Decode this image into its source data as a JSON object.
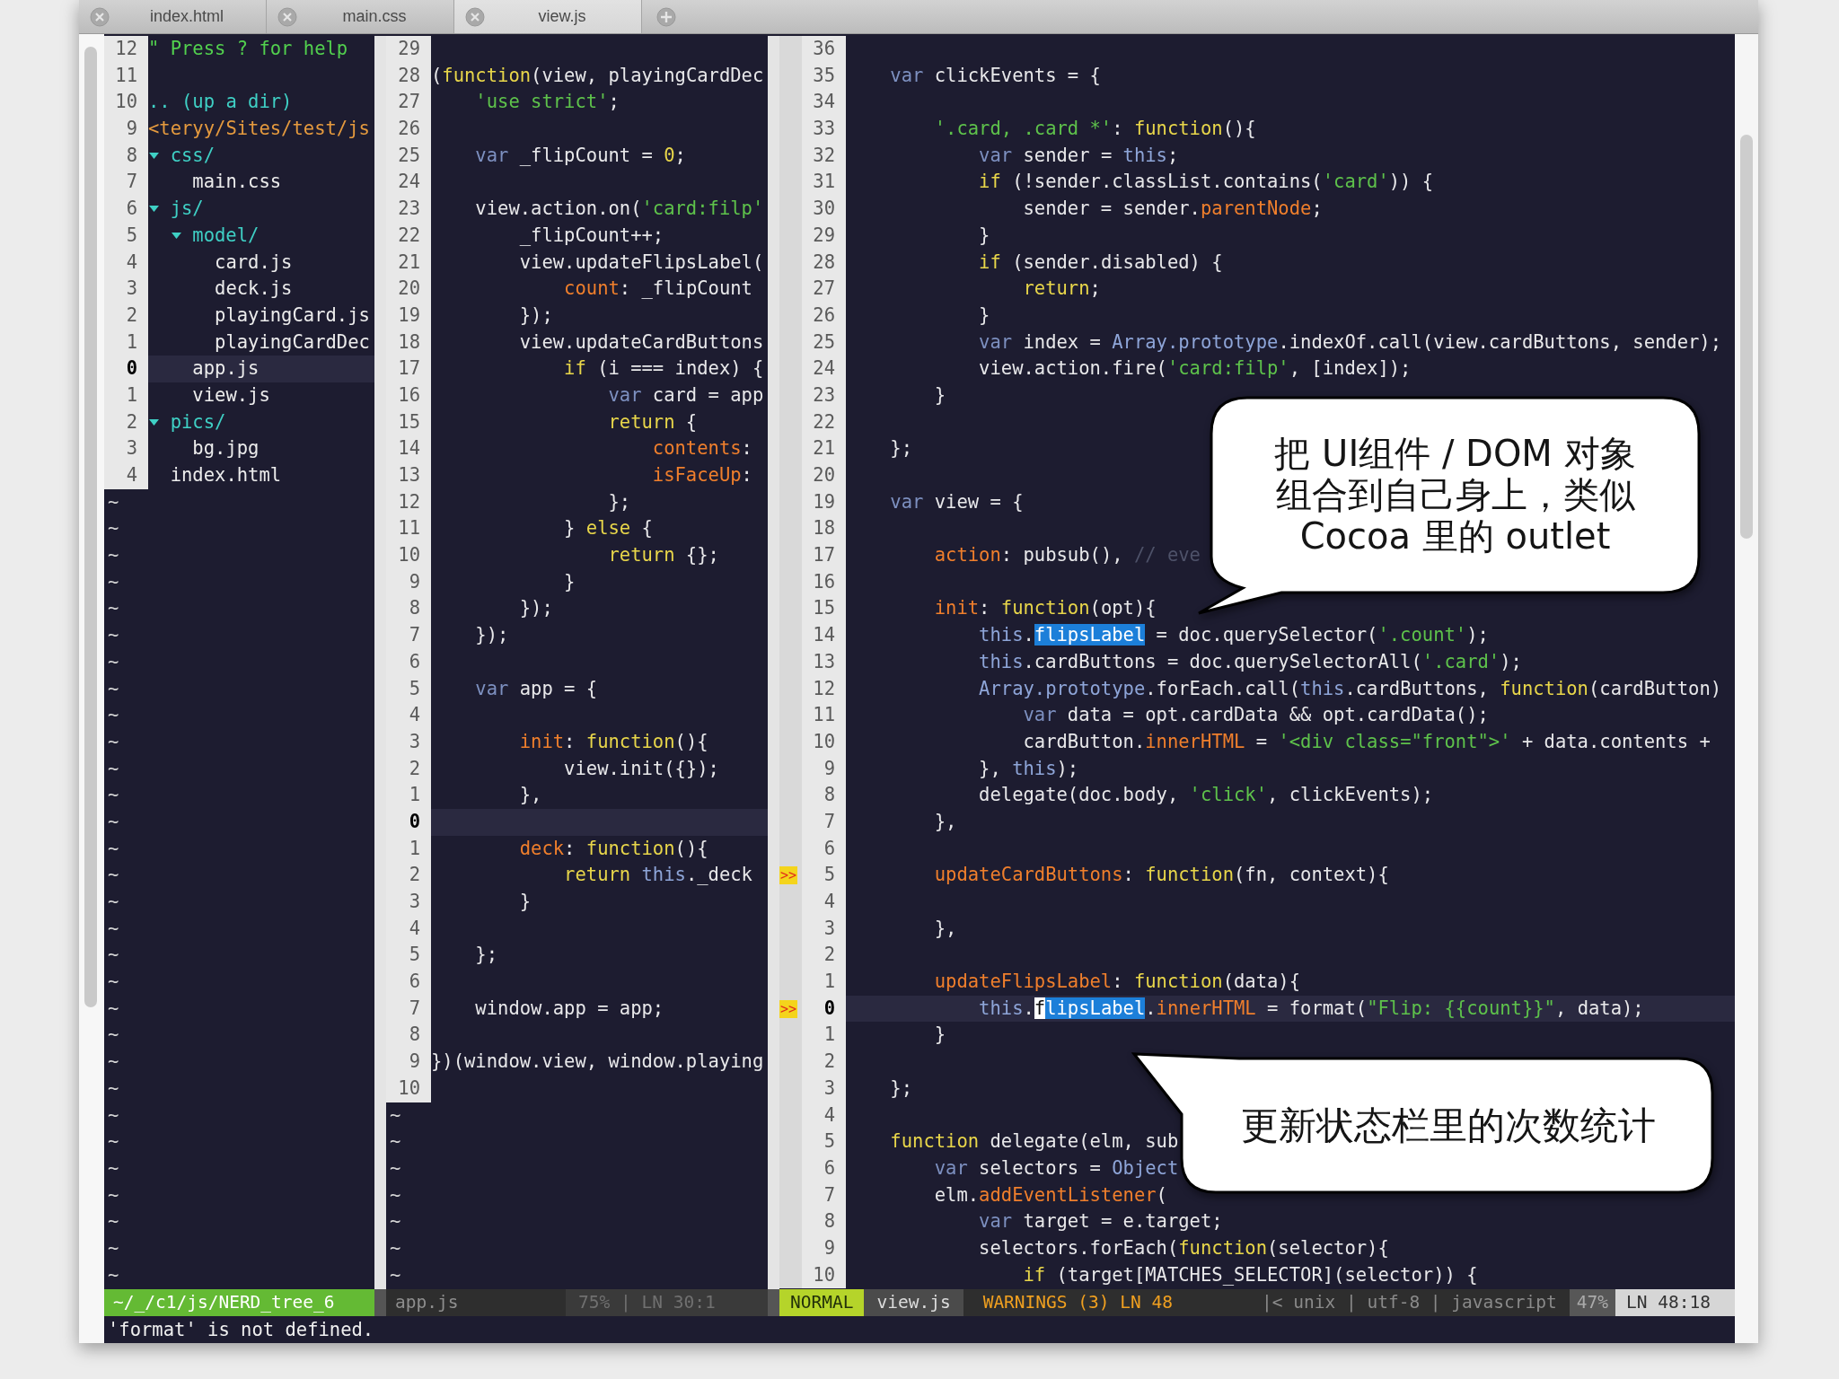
{
  "tabs": [
    {
      "label": "index.html",
      "selected": false
    },
    {
      "label": "main.css",
      "selected": false
    },
    {
      "label": "view.js",
      "selected": true
    }
  ],
  "file_tree": {
    "header": [
      {
        "kind": "help",
        "n": "12",
        "text": "\" Press ? for help"
      },
      {
        "n": "11"
      },
      {
        "kind": "updir",
        "n": "10",
        "text": ".. (up a dir)"
      },
      {
        "kind": "path",
        "n": "9",
        "text": "<teryy/Sites/test/js"
      }
    ],
    "items": [
      {
        "kind": "dir",
        "name": "css/",
        "n": "8",
        "expanded": true,
        "selected": false,
        "children": [
          {
            "kind": "file",
            "name": "main.css",
            "n": "7",
            "selected": false
          }
        ]
      },
      {
        "kind": "dir",
        "name": "js/",
        "n": "6",
        "expanded": true,
        "selected": false,
        "children": [
          {
            "kind": "dir",
            "name": "model/",
            "n": "5",
            "expanded": true,
            "selected": false,
            "children": [
              {
                "kind": "file",
                "name": "card.js",
                "n": "4",
                "selected": false
              },
              {
                "kind": "file",
                "name": "deck.js",
                "n": "3",
                "selected": false
              },
              {
                "kind": "file",
                "name": "playingCard.js",
                "n": "2",
                "selected": false
              },
              {
                "kind": "file",
                "name": "playingCardDec",
                "n": "1",
                "selected": false
              }
            ]
          },
          {
            "kind": "file",
            "name": "app.js",
            "n": "0",
            "selected": true
          },
          {
            "kind": "file",
            "name": "view.js",
            "n": "1",
            "selected": false
          }
        ]
      },
      {
        "kind": "dir",
        "name": "pics/",
        "n": "2",
        "expanded": true,
        "selected": false,
        "children": [
          {
            "kind": "file",
            "name": "bg.jpg",
            "n": "3",
            "selected": false
          }
        ]
      },
      {
        "kind": "file",
        "name": "index.html",
        "n": "4",
        "selected": false
      }
    ],
    "filler": [
      "~",
      "~",
      "~",
      "~",
      "~",
      "~",
      "~",
      "~",
      "~",
      "~",
      "~",
      "~",
      "~",
      "~",
      "~",
      "~",
      "~",
      "~",
      "~",
      "~",
      "~",
      "~",
      "~",
      "~",
      "~",
      "~",
      "~",
      "~",
      "~",
      "~"
    ]
  },
  "editors": [
    {
      "lines": [
        {
          "n": "29",
          "cursor": false
        },
        {
          "n": "28",
          "cursor": false,
          "code": [
            {
              "text": "("
            },
            {
              "text": "function",
              "kind": "kw"
            },
            {
              "text": "(view, playingCardDec"
            }
          ]
        },
        {
          "n": "27",
          "cursor": false,
          "code": [
            {
              "text": "    'use strict'",
              "kind": "str"
            },
            {
              "text": ";"
            }
          ]
        },
        {
          "n": "26",
          "cursor": false
        },
        {
          "n": "25",
          "cursor": false,
          "code": [
            {
              "text": "    var",
              "kind": "var"
            },
            {
              "text": " _flipCount = "
            },
            {
              "text": "0",
              "kind": "num"
            },
            {
              "text": ";"
            }
          ]
        },
        {
          "n": "24",
          "cursor": false
        },
        {
          "n": "23",
          "cursor": false,
          "code": [
            {
              "text": "    view.action.on("
            },
            {
              "text": "'card:filp'",
              "kind": "str"
            }
          ]
        },
        {
          "n": "22",
          "cursor": false,
          "code": [
            {
              "text": "        _flipCount++;"
            }
          ]
        },
        {
          "n": "21",
          "cursor": false,
          "code": [
            {
              "text": "        view.updateFlipsLabel("
            }
          ]
        },
        {
          "n": "20",
          "cursor": false,
          "code": [
            {
              "text": "            count",
              "kind": "prop"
            },
            {
              "text": ": _flipCount"
            }
          ]
        },
        {
          "n": "19",
          "cursor": false,
          "code": [
            {
              "text": "        });"
            }
          ]
        },
        {
          "n": "18",
          "cursor": false,
          "code": [
            {
              "text": "        view.updateCardButtons"
            }
          ]
        },
        {
          "n": "17",
          "cursor": false,
          "code": [
            {
              "text": "            if",
              "kind": "kw"
            },
            {
              "text": " (i === index) {"
            }
          ]
        },
        {
          "n": "16",
          "cursor": false,
          "code": [
            {
              "text": "                var",
              "kind": "var"
            },
            {
              "text": " card = app"
            }
          ]
        },
        {
          "n": "15",
          "cursor": false,
          "code": [
            {
              "text": "                return",
              "kind": "kw"
            },
            {
              "text": " {"
            }
          ]
        },
        {
          "n": "14",
          "cursor": false,
          "code": [
            {
              "text": "                    contents",
              "kind": "prop"
            },
            {
              "text": ":"
            }
          ]
        },
        {
          "n": "13",
          "cursor": false,
          "code": [
            {
              "text": "                    isFaceUp",
              "kind": "prop"
            },
            {
              "text": ":"
            }
          ]
        },
        {
          "n": "12",
          "cursor": false,
          "code": [
            {
              "text": "                };"
            }
          ]
        },
        {
          "n": "11",
          "cursor": false,
          "code": [
            {
              "text": "            } "
            },
            {
              "text": "else",
              "kind": "kw"
            },
            {
              "text": " {"
            }
          ]
        },
        {
          "n": "10",
          "cursor": false,
          "code": [
            {
              "text": "                return",
              "kind": "kw"
            },
            {
              "text": " {};"
            }
          ]
        },
        {
          "n": "9",
          "cursor": false,
          "code": [
            {
              "text": "            }"
            }
          ]
        },
        {
          "n": "8",
          "cursor": false,
          "code": [
            {
              "text": "        });"
            }
          ]
        },
        {
          "n": "7",
          "cursor": false,
          "code": [
            {
              "text": "    });"
            }
          ]
        },
        {
          "n": "6",
          "cursor": false
        },
        {
          "n": "5",
          "cursor": false,
          "code": [
            {
              "text": "    var",
              "kind": "var"
            },
            {
              "text": " app = {"
            }
          ]
        },
        {
          "n": "4",
          "cursor": false
        },
        {
          "n": "3",
          "cursor": false,
          "code": [
            {
              "text": "        init",
              "kind": "prop"
            },
            {
              "text": ": "
            },
            {
              "text": "function",
              "kind": "kw"
            },
            {
              "text": "(){"
            }
          ]
        },
        {
          "n": "2",
          "cursor": false,
          "code": [
            {
              "text": "            view.init({});"
            }
          ]
        },
        {
          "n": "1",
          "cursor": false,
          "code": [
            {
              "text": "        },"
            }
          ]
        },
        {
          "n": "0",
          "cursor": true
        },
        {
          "n": "1",
          "cursor": false,
          "code": [
            {
              "text": "        deck",
              "kind": "prop"
            },
            {
              "text": ": "
            },
            {
              "text": "function",
              "kind": "kw"
            },
            {
              "text": "(){"
            }
          ]
        },
        {
          "n": "2",
          "cursor": false,
          "code": [
            {
              "text": "            return",
              "kind": "kw"
            },
            {
              "text": " this",
              "kind": "this"
            },
            {
              "text": "._deck"
            }
          ]
        },
        {
          "n": "3",
          "cursor": false,
          "code": [
            {
              "text": "        }"
            }
          ]
        },
        {
          "n": "4",
          "cursor": false
        },
        {
          "n": "5",
          "cursor": false,
          "code": [
            {
              "text": "    };"
            }
          ]
        },
        {
          "n": "6",
          "cursor": false
        },
        {
          "n": "7",
          "cursor": false,
          "code": [
            {
              "text": "    window.app = app;"
            }
          ]
        },
        {
          "n": "8",
          "cursor": false
        },
        {
          "n": "9",
          "cursor": false,
          "code": [
            {
              "text": "})(window.view, window.playing"
            }
          ]
        },
        {
          "n": "10",
          "cursor": false
        }
      ],
      "filler": [
        "~",
        "~",
        "~",
        "~",
        "~",
        "~",
        "~"
      ]
    },
    {
      "lines": [
        {
          "n": "36",
          "cursor": false
        },
        {
          "n": "35",
          "cursor": false,
          "code": [
            {
              "text": "    var",
              "kind": "var"
            },
            {
              "text": " clickEvents = {"
            }
          ]
        },
        {
          "n": "34",
          "cursor": false
        },
        {
          "n": "33",
          "cursor": false,
          "code": [
            {
              "text": "        '.card, .card *'",
              "kind": "str"
            },
            {
              "text": ": "
            },
            {
              "text": "function",
              "kind": "kw"
            },
            {
              "text": "(){"
            }
          ]
        },
        {
          "n": "32",
          "cursor": false,
          "code": [
            {
              "text": "            var",
              "kind": "var"
            },
            {
              "text": " sender = "
            },
            {
              "text": "this",
              "kind": "this"
            },
            {
              "text": ";"
            }
          ]
        },
        {
          "n": "31",
          "cursor": false,
          "code": [
            {
              "text": "            if",
              "kind": "kw"
            },
            {
              "text": " (!sender.classList.contains("
            },
            {
              "text": "'card'",
              "kind": "str"
            },
            {
              "text": ")) {"
            }
          ]
        },
        {
          "n": "30",
          "cursor": false,
          "code": [
            {
              "text": "                sender = sender."
            },
            {
              "text": "parentNode",
              "kind": "prop"
            },
            {
              "text": ";"
            }
          ]
        },
        {
          "n": "29",
          "cursor": false,
          "code": [
            {
              "text": "            }"
            }
          ]
        },
        {
          "n": "28",
          "cursor": false,
          "code": [
            {
              "text": "            if",
              "kind": "kw"
            },
            {
              "text": " (sender.disabled) {"
            }
          ]
        },
        {
          "n": "27",
          "cursor": false,
          "code": [
            {
              "text": "                return",
              "kind": "kw"
            },
            {
              "text": ";"
            }
          ]
        },
        {
          "n": "26",
          "cursor": false,
          "code": [
            {
              "text": "            }"
            }
          ]
        },
        {
          "n": "25",
          "cursor": false,
          "code": [
            {
              "text": "            var",
              "kind": "var"
            },
            {
              "text": " index = "
            },
            {
              "text": "Array.prototype",
              "kind": "this"
            },
            {
              "text": ".indexOf.call(view.cardButtons, sender);"
            }
          ]
        },
        {
          "n": "24",
          "cursor": false,
          "code": [
            {
              "text": "            view.action.fire("
            },
            {
              "text": "'card:filp'",
              "kind": "str"
            },
            {
              "text": ", [index]);"
            }
          ]
        },
        {
          "n": "23",
          "cursor": false,
          "code": [
            {
              "text": "        }"
            }
          ]
        },
        {
          "n": "22",
          "cursor": false
        },
        {
          "n": "21",
          "cursor": false,
          "code": [
            {
              "text": "    };"
            }
          ]
        },
        {
          "n": "20",
          "cursor": false
        },
        {
          "n": "19",
          "cursor": false,
          "code": [
            {
              "text": "    var",
              "kind": "var"
            },
            {
              "text": " view = {"
            }
          ]
        },
        {
          "n": "18",
          "cursor": false
        },
        {
          "n": "17",
          "cursor": false,
          "code": [
            {
              "text": "        action",
              "kind": "prop"
            },
            {
              "text": ": pubsub(), "
            },
            {
              "text": "// eve",
              "kind": "cmt"
            }
          ]
        },
        {
          "n": "16",
          "cursor": false
        },
        {
          "n": "15",
          "cursor": false,
          "code": [
            {
              "text": "        init",
              "kind": "prop"
            },
            {
              "text": ": "
            },
            {
              "text": "function",
              "kind": "kw"
            },
            {
              "text": "(opt){"
            }
          ]
        },
        {
          "n": "14",
          "cursor": false,
          "code": [
            {
              "text": "            this",
              "kind": "this"
            },
            {
              "text": "."
            },
            {
              "text": "flipsLabel",
              "kind": "match"
            },
            {
              "text": " = doc.querySelector("
            },
            {
              "text": "'.count'",
              "kind": "str"
            },
            {
              "text": ");"
            }
          ]
        },
        {
          "n": "13",
          "cursor": false,
          "code": [
            {
              "text": "            this",
              "kind": "this"
            },
            {
              "text": ".cardButtons = doc.querySelectorAll("
            },
            {
              "text": "'.card'",
              "kind": "str"
            },
            {
              "text": ");"
            }
          ]
        },
        {
          "n": "12",
          "cursor": false,
          "code": [
            {
              "text": "            Array.prototype",
              "kind": "this"
            },
            {
              "text": ".forEach.call("
            },
            {
              "text": "this",
              "kind": "this"
            },
            {
              "text": ".cardButtons, "
            },
            {
              "text": "function",
              "kind": "kw"
            },
            {
              "text": "(cardButton)"
            }
          ]
        },
        {
          "n": "11",
          "cursor": false,
          "code": [
            {
              "text": "                var",
              "kind": "var"
            },
            {
              "text": " data = opt.cardData && opt.cardData();"
            }
          ]
        },
        {
          "n": "10",
          "cursor": false,
          "code": [
            {
              "text": "                cardButton."
            },
            {
              "text": "innerHTML",
              "kind": "prop"
            },
            {
              "text": " = "
            },
            {
              "text": "'<div class=\"front\">'",
              "kind": "str"
            },
            {
              "text": " + data.contents +"
            }
          ]
        },
        {
          "n": "9",
          "cursor": false,
          "code": [
            {
              "text": "            }, "
            },
            {
              "text": "this",
              "kind": "this"
            },
            {
              "text": ");"
            }
          ]
        },
        {
          "n": "8",
          "cursor": false,
          "code": [
            {
              "text": "            delegate(doc.body, "
            },
            {
              "text": "'click'",
              "kind": "str"
            },
            {
              "text": ", clickEvents);"
            }
          ]
        },
        {
          "n": "7",
          "cursor": false,
          "code": [
            {
              "text": "        },"
            }
          ]
        },
        {
          "n": "6",
          "cursor": false
        },
        {
          "n": "5",
          "cursor": false,
          "sign": ">>",
          "code": [
            {
              "text": "        updateCardButtons",
              "kind": "prop"
            },
            {
              "text": ": "
            },
            {
              "text": "function",
              "kind": "kw"
            },
            {
              "text": "(fn, context){"
            }
          ]
        },
        {
          "n": "4",
          "cursor": false
        },
        {
          "n": "3",
          "cursor": false,
          "code": [
            {
              "text": "        },"
            }
          ]
        },
        {
          "n": "2",
          "cursor": false
        },
        {
          "n": "1",
          "cursor": false,
          "code": [
            {
              "text": "        updateFlipsLabel",
              "kind": "prop"
            },
            {
              "text": ": "
            },
            {
              "text": "function",
              "kind": "kw"
            },
            {
              "text": "(data){"
            }
          ]
        },
        {
          "n": "0",
          "cursor": true,
          "sign": ">>",
          "code": [
            {
              "text": "            this",
              "kind": "this"
            },
            {
              "text": "."
            },
            {
              "text": "f",
              "kind": "cur"
            },
            {
              "text": "lipsLabel",
              "kind": "match"
            },
            {
              "text": "."
            },
            {
              "text": "innerHTML",
              "kind": "prop"
            },
            {
              "text": " = format("
            },
            {
              "text": "\"Flip: {{count}}\"",
              "kind": "str"
            },
            {
              "text": ", data);"
            }
          ]
        },
        {
          "n": "1",
          "cursor": false,
          "code": [
            {
              "text": "        }"
            }
          ]
        },
        {
          "n": "2",
          "cursor": false
        },
        {
          "n": "3",
          "cursor": false,
          "code": [
            {
              "text": "    };"
            }
          ]
        },
        {
          "n": "4",
          "cursor": false
        },
        {
          "n": "5",
          "cursor": false,
          "code": [
            {
              "text": "    function",
              "kind": "kw"
            },
            {
              "text": " delegate(elm, sub"
            }
          ]
        },
        {
          "n": "6",
          "cursor": false,
          "code": [
            {
              "text": "        var",
              "kind": "var"
            },
            {
              "text": " selectors = "
            },
            {
              "text": "Object",
              "kind": "this"
            }
          ]
        },
        {
          "n": "7",
          "cursor": false,
          "code": [
            {
              "text": "        elm."
            },
            {
              "text": "addEventListener",
              "kind": "prop"
            },
            {
              "text": "("
            }
          ]
        },
        {
          "n": "8",
          "cursor": false,
          "code": [
            {
              "text": "            var",
              "kind": "var"
            },
            {
              "text": " target = e.target;"
            }
          ]
        },
        {
          "n": "9",
          "cursor": false,
          "code": [
            {
              "text": "            selectors.forEach("
            },
            {
              "text": "function",
              "kind": "kw"
            },
            {
              "text": "(selector){"
            }
          ]
        },
        {
          "n": "10",
          "cursor": false,
          "code": [
            {
              "text": "                if",
              "kind": "kw"
            },
            {
              "text": " (target[MATCHES_SELECTOR](selector)) {"
            }
          ]
        }
      ]
    }
  ],
  "statusline": {
    "tree_path": "~/_/c1/js/NERD_tree_6",
    "left_file": "app.js",
    "left_position": "75% | LN 30:1",
    "mode": "NORMAL",
    "file": "view.js",
    "warnings": "WARNINGS (3) LN 48",
    "file_info": "|< unix | utf-8 | javascript",
    "percent": "47%",
    "position": "LN 48:18"
  },
  "message": "'format' is not defined.",
  "callouts": [
    {
      "lines": [
        "把 UI组件 / DOM 对象",
        "组合到自己身上，类似",
        "Cocoa 里的 outlet"
      ]
    },
    {
      "lines": [
        "更新状态栏里的次数统计"
      ]
    }
  ]
}
